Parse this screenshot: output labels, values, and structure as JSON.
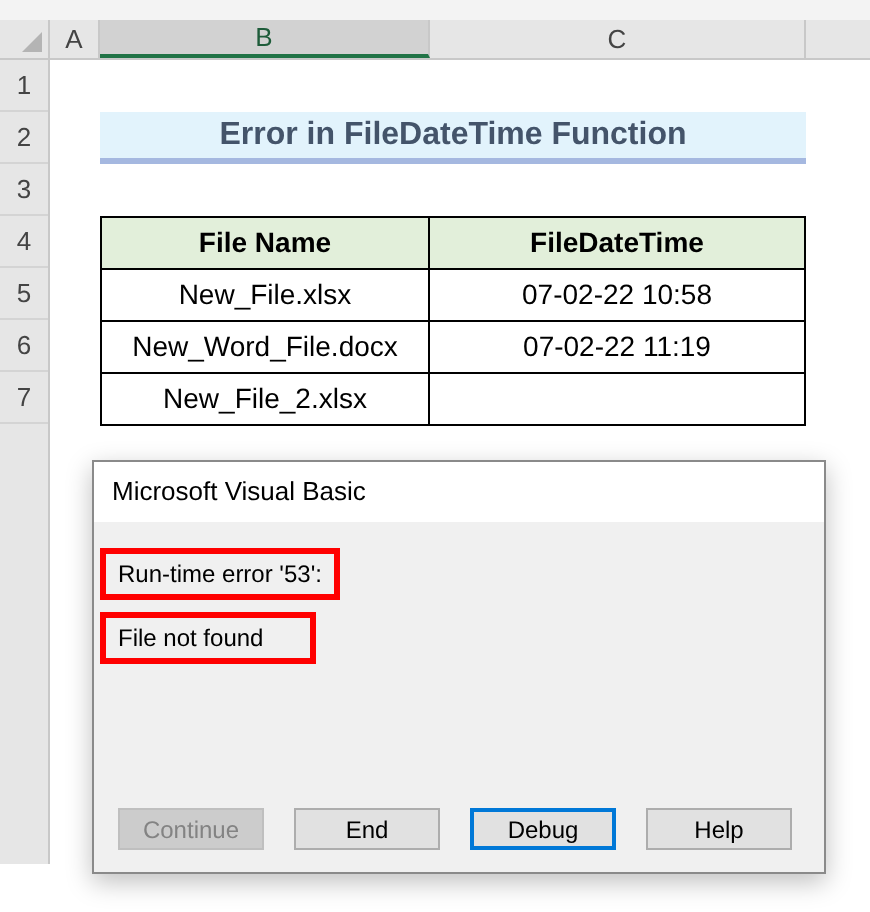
{
  "columns": [
    {
      "label": "A",
      "selected": false
    },
    {
      "label": "B",
      "selected": true
    },
    {
      "label": "C",
      "selected": false
    }
  ],
  "row_headers": [
    "1",
    "2",
    "3",
    "4",
    "5",
    "6",
    "7"
  ],
  "sheet_title": "Error in FileDateTime Function",
  "table": {
    "columns": [
      "File Name",
      "FileDateTime"
    ],
    "rows": [
      [
        "New_File.xlsx",
        "07-02-22 10:58"
      ],
      [
        "New_Word_File.docx",
        "07-02-22 11:19"
      ],
      [
        "New_File_2.xlsx"
      ]
    ]
  },
  "dialog": {
    "title": "Microsoft Visual Basic",
    "messages": [
      {
        "text": "Run-time error '53':",
        "highlighted": true
      },
      {
        "text": "File not found",
        "highlighted": true
      }
    ],
    "buttons": [
      {
        "label": "Continue",
        "disabled": true,
        "focused": false
      },
      {
        "label": "End",
        "disabled": false,
        "focused": false
      },
      {
        "label": "Debug",
        "disabled": false,
        "focused": true
      },
      {
        "label": "Help",
        "disabled": false,
        "focused": false
      }
    ]
  }
}
